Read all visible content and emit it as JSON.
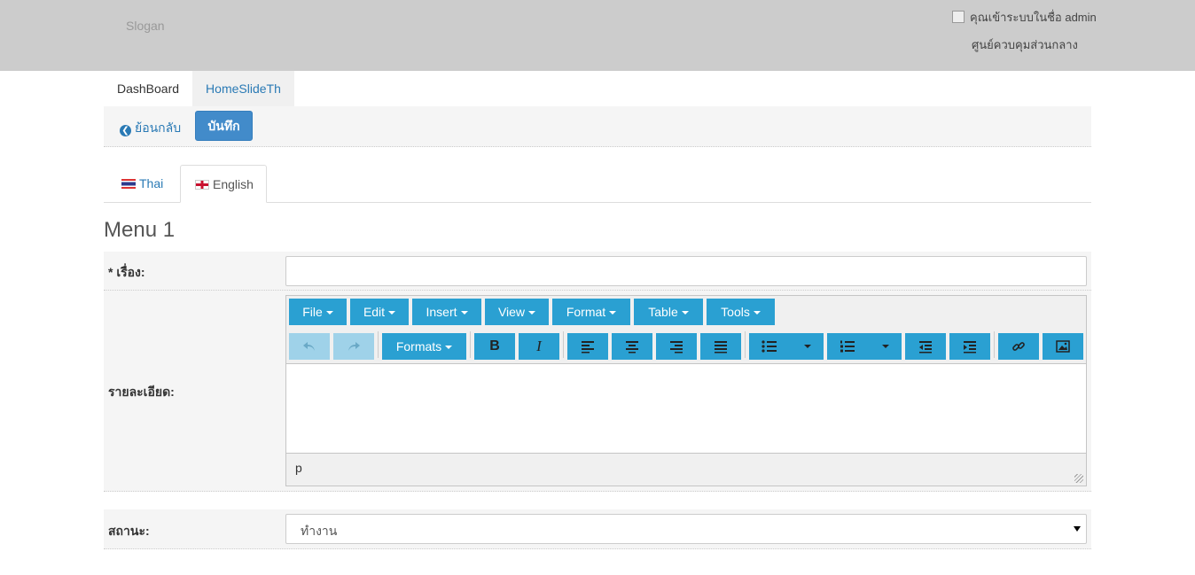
{
  "header": {
    "slogan": "Slogan",
    "user_text": "คุณเข้าระบบในชื่อ admin",
    "org_name": "ศูนย์ควบคุมส่วนกลาง"
  },
  "nav": {
    "items": [
      {
        "label": "DashBoard"
      },
      {
        "label": "HomeSlideTh"
      }
    ]
  },
  "actions": {
    "back_label": "ย้อนกลับ",
    "save_label": "บันทึก"
  },
  "lang_tabs": [
    {
      "label": "Thai"
    },
    {
      "label": "English"
    }
  ],
  "section": {
    "title": "Menu 1"
  },
  "form": {
    "title_label": "* เรื่อง:",
    "title_value": "",
    "detail_label": "รายละเอียด:",
    "status_label": "สถานะ:",
    "status_value": "ทำงาน"
  },
  "editor": {
    "menubar": [
      {
        "label": "File"
      },
      {
        "label": "Edit"
      },
      {
        "label": "Insert"
      },
      {
        "label": "View"
      },
      {
        "label": "Format"
      },
      {
        "label": "Table"
      },
      {
        "label": "Tools"
      }
    ],
    "formats_label": "Formats",
    "bold_label": "B",
    "italic_label": "I",
    "status_path": "p",
    "icons": [
      "undo-icon",
      "redo-icon",
      "align-left-icon",
      "align-center-icon",
      "align-right-icon",
      "align-justify-icon",
      "bullet-list-icon",
      "numbered-list-icon",
      "outdent-icon",
      "indent-icon",
      "link-icon",
      "image-icon"
    ]
  },
  "colors": {
    "header_bg": "#cccccc",
    "primary": "#428bca",
    "editor_button": "#2aa0d2",
    "link": "#2a7ab5"
  }
}
